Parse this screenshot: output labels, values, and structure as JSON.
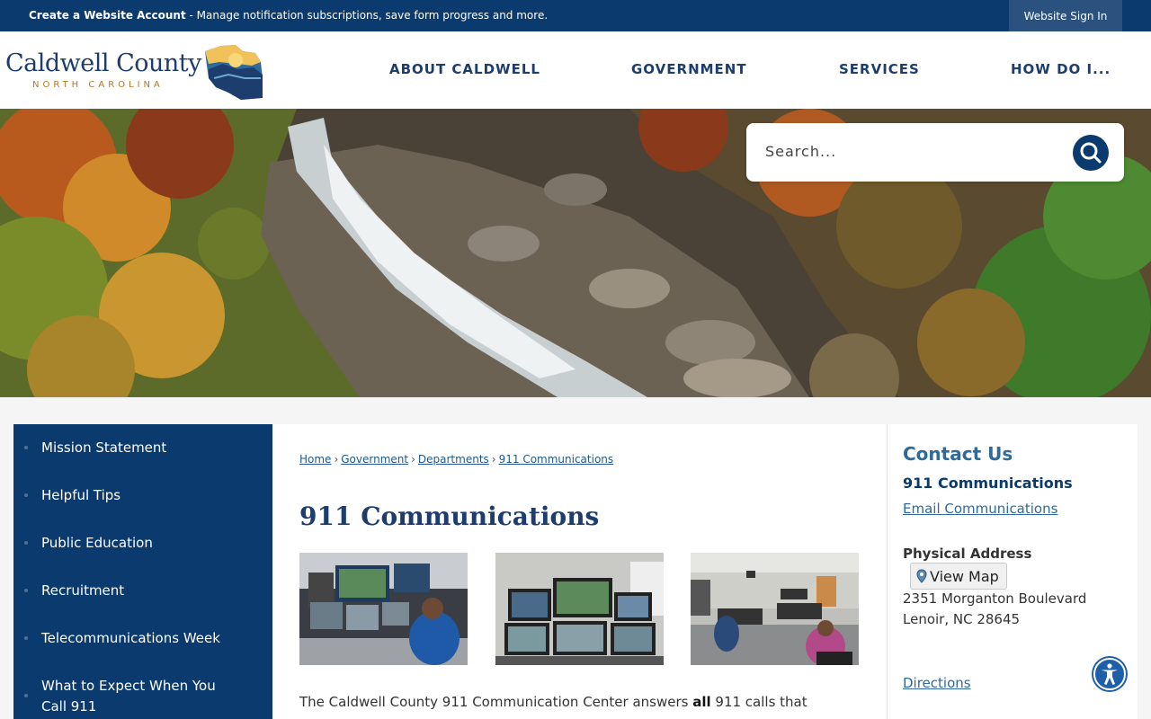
{
  "topbar": {
    "create_label": "Create a Website Account",
    "create_desc": " - Manage notification subscriptions, save form progress and more.",
    "signin_label": "Website Sign In"
  },
  "logo": {
    "name": "Caldwell County",
    "subtitle": "NORTH CAROLINA"
  },
  "nav": {
    "items": [
      "ABOUT CALDWELL",
      "GOVERNMENT",
      "SERVICES",
      "HOW DO I..."
    ]
  },
  "search": {
    "placeholder": "Search..."
  },
  "sidebar": {
    "items": [
      {
        "label": "Mission Statement"
      },
      {
        "label": "Helpful Tips"
      },
      {
        "label": "Public Education"
      },
      {
        "label": "Recruitment"
      },
      {
        "label": "Telecommunications Week"
      },
      {
        "label_line1": "What to Expect When You",
        "label_line2": "Call 911"
      }
    ]
  },
  "breadcrumb": {
    "items": [
      "Home",
      "Government",
      "Departments",
      "911 Communications"
    ],
    "separator": "›"
  },
  "main": {
    "title": "911 Communications",
    "intro_before": "The Caldwell County 911 Communication Center answers ",
    "intro_bold": "all",
    "intro_after": " 911 calls that"
  },
  "contact": {
    "title": "Contact Us",
    "department": "911 Communications",
    "email_label": "Email Communications",
    "address_label": "Physical Address",
    "map_label": "View Map",
    "address_line1": "2351 Morganton Boulevard",
    "address_line2": "Lenoir, NC 28645",
    "directions_label": "Directions"
  },
  "colors": {
    "brand_navy": "#0a3a6e",
    "link_blue": "#2e6b9a",
    "logo_gold": "#b07a2a"
  },
  "icons": {
    "search": "search-icon",
    "map_pin": "map-pin-icon",
    "accessibility": "accessibility-icon"
  }
}
